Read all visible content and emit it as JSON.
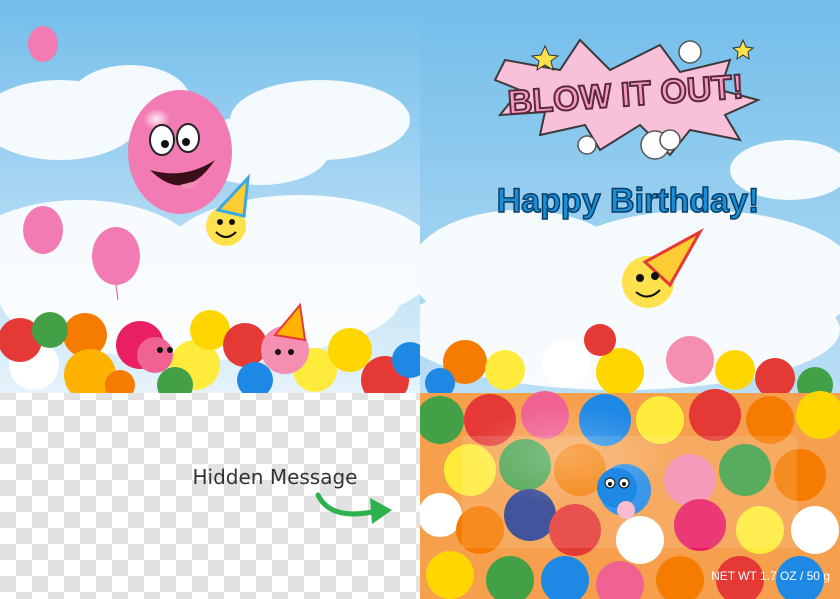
{
  "card": {
    "banner_text": "BLOW IT OUT!",
    "greeting": "Happy Birthday!",
    "hidden_label": "Hidden Message",
    "net_weight": "NET WT 1.7 OZ / 50 g"
  },
  "colors": {
    "sky_top": "#7fc4ec",
    "sky_bottom": "#d9eefb",
    "banner_pink": "#f59ac0",
    "greeting_blue": "#1b8fd6",
    "arrow_green": "#2bb24c",
    "balloon_pink": "#f27bb3",
    "face_yellow": "#ffe14d"
  }
}
